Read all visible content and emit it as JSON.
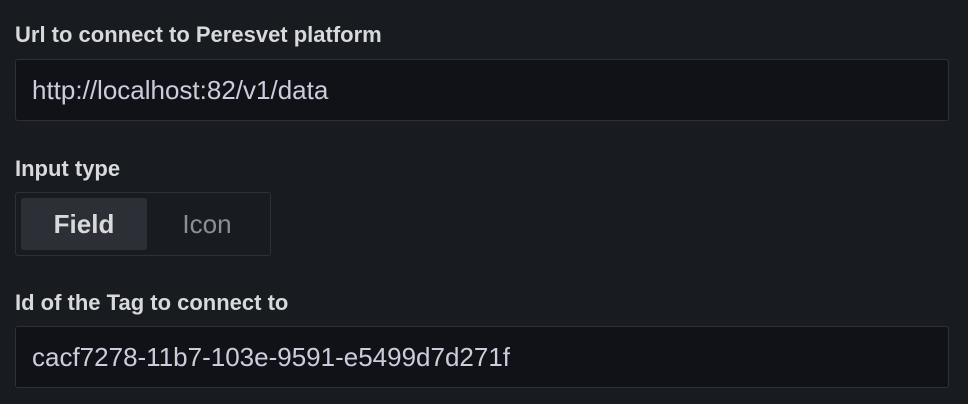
{
  "url_field": {
    "label": "Url to connect to Peresvet platform",
    "value": "http://localhost:82/v1/data"
  },
  "input_type": {
    "label": "Input type",
    "options": [
      "Field",
      "Icon"
    ],
    "selected": "Field"
  },
  "tag_field": {
    "label": "Id of the Tag to connect to",
    "value": "cacf7278-11b7-103e-9591-e5499d7d271f"
  },
  "colors": {
    "background": "#181b1f",
    "input_background": "#111217",
    "border": "#2e3037",
    "selected_option_background": "#2c2f36",
    "label_text": "#d8d9da",
    "muted_text": "#8e8f94"
  }
}
